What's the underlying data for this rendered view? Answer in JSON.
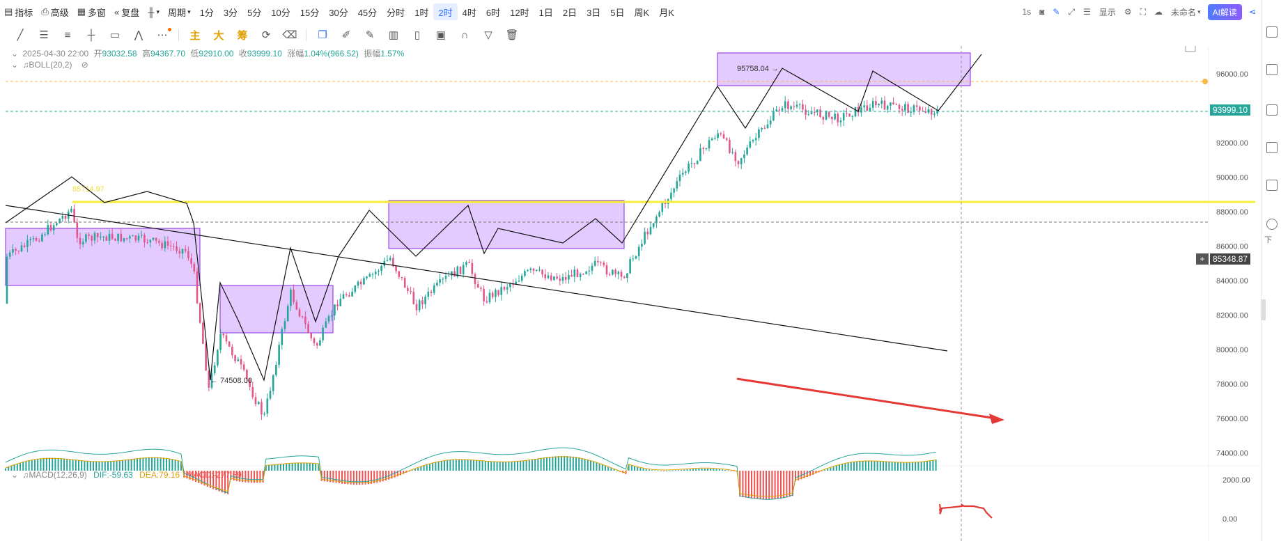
{
  "toolbar": {
    "indicator": "指标",
    "advanced": "高级",
    "multi_window": "多窗",
    "replay": "复盘",
    "period_label": "周期",
    "periods": [
      "1分",
      "3分",
      "5分",
      "10分",
      "15分",
      "30分",
      "45分",
      "分时",
      "1时",
      "2时",
      "4时",
      "6时",
      "12时",
      "1日",
      "2日",
      "3日",
      "5日",
      "周K",
      "月K"
    ],
    "active_period": "2时",
    "interval": "1s",
    "display": "显示",
    "unnamed": "未命名",
    "ai": "AI解读"
  },
  "drawing_tools": {
    "main": "主",
    "big": "大",
    "chip": "筹"
  },
  "ohlc": {
    "datetime": "2025-04-30 22:00",
    "open_label": "开",
    "open": "93032.58",
    "high_label": "高",
    "high": "94367.70",
    "low_label": "低",
    "low": "92910.00",
    "close_label": "收",
    "close": "93999.10",
    "change_label": "涨幅",
    "change": "1.04%(966.52)",
    "amplitude_label": "振幅",
    "amplitude": "1.57%"
  },
  "boll": {
    "label": "BOLL(20,2)"
  },
  "macd": {
    "label": "MACD(12,26,9)",
    "dif": "DIF:-59.63",
    "dea": "DEA:79.16",
    "macd": "MACD:-277.59"
  },
  "price_axis": {
    "ticks": [
      "96000.00",
      "94000.00",
      "92000.00",
      "90000.00",
      "88000.00",
      "86000.00",
      "84000.00",
      "82000.00",
      "80000.00",
      "78000.00",
      "76000.00",
      "74000.00"
    ],
    "macd_ticks": [
      "2000.00",
      "0.00"
    ]
  },
  "price_tags": {
    "current": "93999.10",
    "crosshair": "85348.87"
  },
  "annotations": {
    "high_label": "95758.04 →",
    "low_label": "← 74508.00",
    "yellow_line_label": "85714.97"
  },
  "sidebar": {
    "download": "下"
  },
  "colors": {
    "up": "#26a69a",
    "down": "#ef5350",
    "box_fill": "#d9b8ff",
    "box_stroke": "#8a2be2",
    "yellow_line": "#f7ec3a",
    "arrow": "#e53935"
  }
}
